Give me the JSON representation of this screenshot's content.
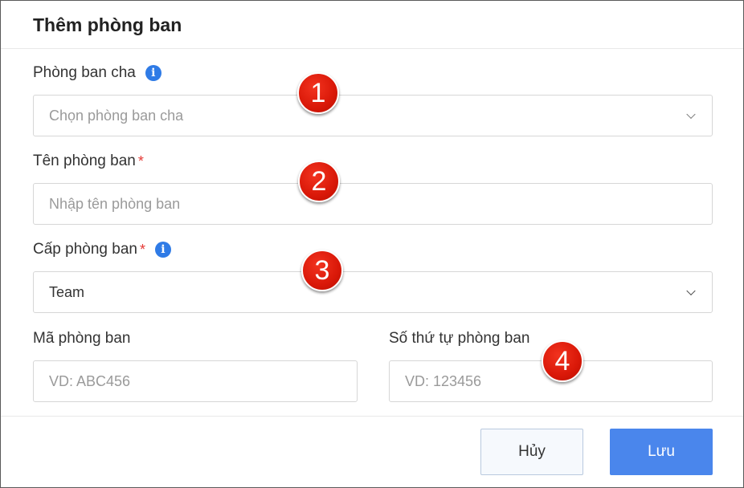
{
  "dialog": {
    "title": "Thêm phòng ban",
    "parent_department": {
      "label": "Phòng ban cha",
      "placeholder": "Chọn phòng ban cha",
      "info_icon": "info-icon"
    },
    "department_name": {
      "label": "Tên phòng ban",
      "required_mark": "*",
      "placeholder": "Nhập tên phòng ban"
    },
    "department_level": {
      "label": "Cấp phòng ban",
      "required_mark": "*",
      "value": "Team",
      "info_icon": "info-icon"
    },
    "department_code": {
      "label": "Mã phòng ban",
      "placeholder": "VD: ABC456"
    },
    "department_order": {
      "label": "Số thứ tự phòng ban",
      "placeholder": "VD: 123456"
    },
    "buttons": {
      "cancel": "Hủy",
      "save": "Lưu"
    }
  },
  "annotations": [
    "1",
    "2",
    "3",
    "4"
  ],
  "colors": {
    "accent": "#4a86ec",
    "info": "#2f7be6",
    "required": "#e53935",
    "marker": "#d91808"
  }
}
